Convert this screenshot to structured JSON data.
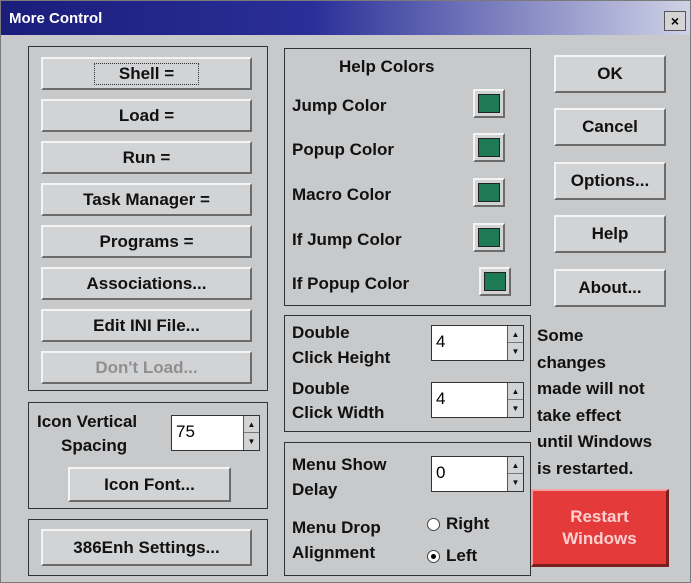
{
  "window": {
    "title": "More Control",
    "close_glyph": "×"
  },
  "left_buttons": [
    "Shell =",
    "Load =",
    "Run =",
    "Task Manager =",
    "Programs =",
    "Associations...",
    "Edit INI File...",
    "Don't Load..."
  ],
  "icon_spacing": {
    "label_line1": "Icon Vertical",
    "label_line2": "Spacing",
    "value": "75",
    "font_button": "Icon Font..."
  },
  "enh_button": "386Enh Settings...",
  "help_colors": {
    "title": "Help Colors",
    "items": [
      {
        "label": "Jump Color",
        "color": "#1d7a55"
      },
      {
        "label": "Popup Color",
        "color": "#1d7a55"
      },
      {
        "label": "Macro Color",
        "color": "#1d7a55"
      },
      {
        "label": "If Jump Color",
        "color": "#1d7a55"
      },
      {
        "label": "If Popup Color",
        "color": "#1d7a55"
      }
    ]
  },
  "double_click": {
    "height_line1": "Double",
    "height_line2": "Click Height",
    "height_value": "4",
    "width_line1": "Double",
    "width_line2": "Click Width",
    "width_value": "4"
  },
  "menu": {
    "delay_line1": "Menu Show",
    "delay_line2": "Delay",
    "delay_value": "0",
    "align_line1": "Menu Drop",
    "align_line2": "Alignment",
    "options": [
      "Right",
      "Left"
    ],
    "selected": "Left"
  },
  "right_buttons": [
    "OK",
    "Cancel",
    "Options...",
    "Help",
    "About..."
  ],
  "note_lines": [
    "Some",
    "changes",
    "made will not",
    "take effect",
    "until Windows",
    "is restarted."
  ],
  "restart": {
    "line1": "Restart",
    "line2": "Windows"
  }
}
